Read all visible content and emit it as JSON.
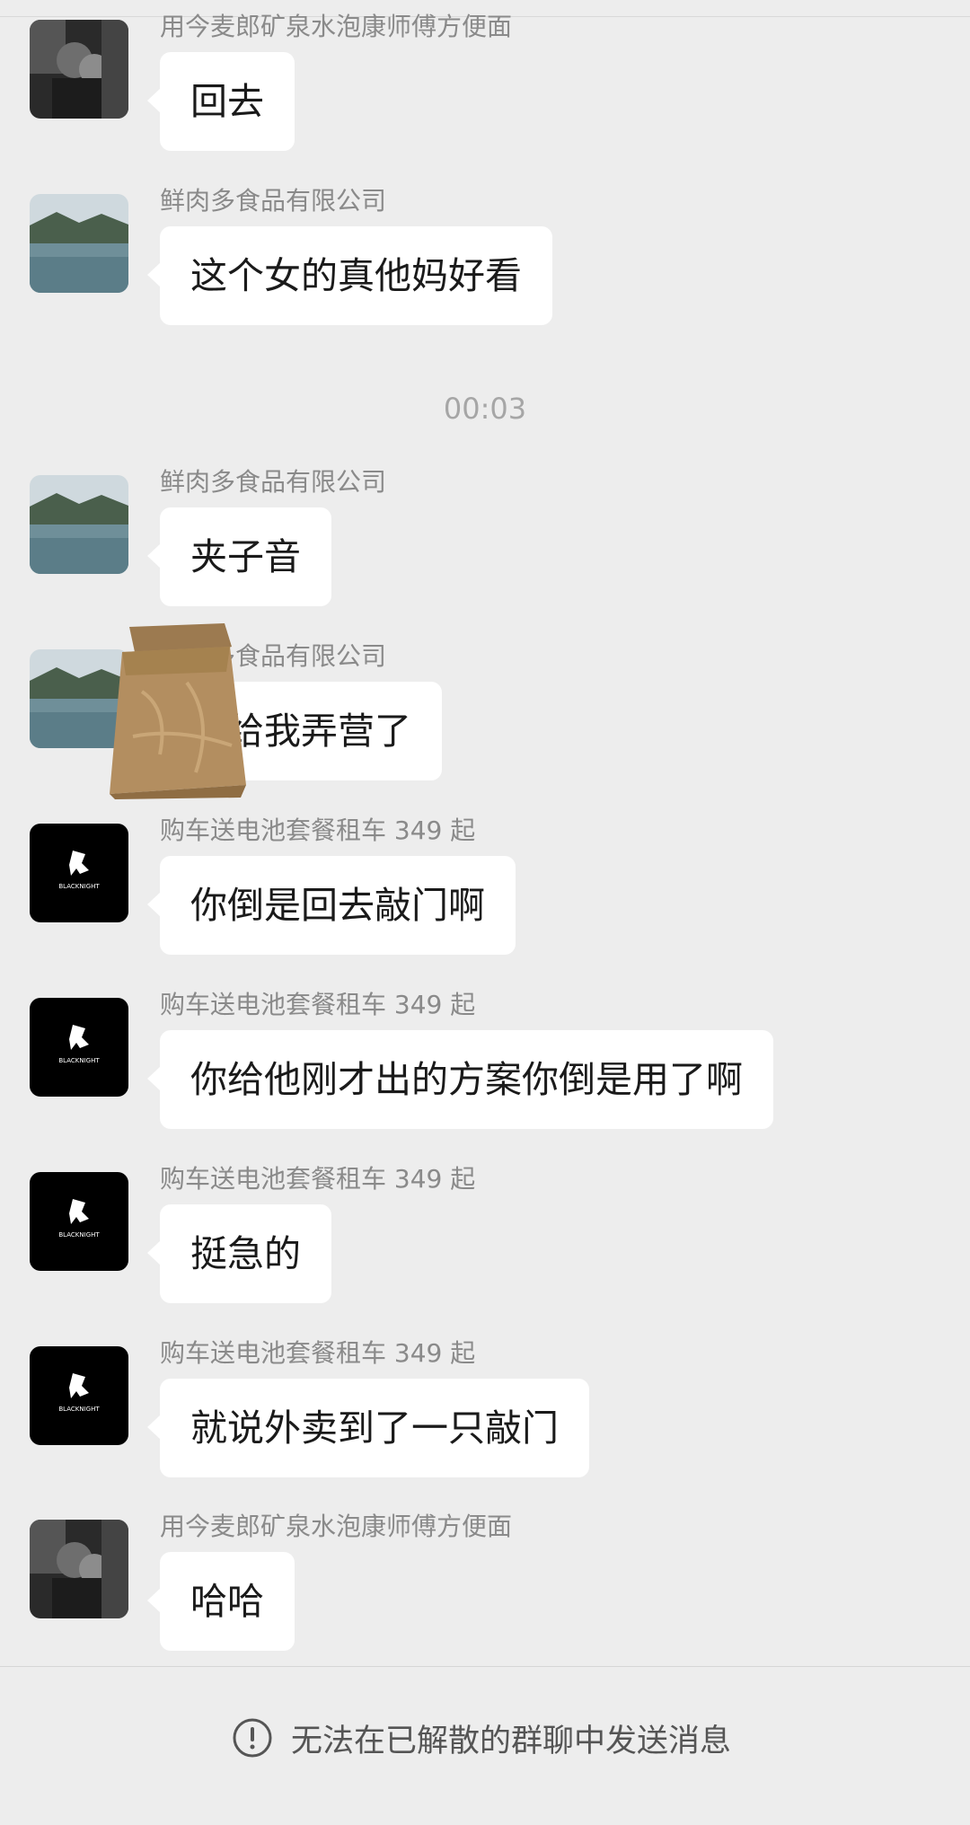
{
  "messages": [
    {
      "sender": "用今麦郎矿泉水泡康师傅方便面",
      "text": "回去",
      "avatar": "couple-photo-avatar"
    },
    {
      "sender": "鲜肉多食品有限公司",
      "text": "这个女的真他妈好看",
      "avatar": "lake-landscape-avatar"
    },
    {
      "sender": "鲜肉多食品有限公司",
      "text": "夹子音",
      "avatar": "lake-landscape-avatar"
    },
    {
      "sender": "鲜肉多食品有限公司",
      "text": "巴给我弄营了",
      "avatar": "lake-landscape-avatar"
    },
    {
      "sender": "购车送电池套餐租车 349 起",
      "text": "你倒是回去敲门啊",
      "avatar": "blackknight-logo-avatar"
    },
    {
      "sender": "购车送电池套餐租车 349 起",
      "text": "你给他刚才出的方案你倒是用了啊",
      "avatar": "blackknight-logo-avatar"
    },
    {
      "sender": "购车送电池套餐租车 349 起",
      "text": "挺急的",
      "avatar": "blackknight-logo-avatar"
    },
    {
      "sender": "购车送电池套餐租车 349 起",
      "text": "就说外卖到了一只敲门",
      "avatar": "blackknight-logo-avatar"
    },
    {
      "sender": "用今麦郎矿泉水泡康师傅方便面",
      "text": "哈哈",
      "avatar": "couple-photo-avatar"
    }
  ],
  "timestamp": "00:03",
  "footer": {
    "notice": "无法在已解散的群聊中发送消息",
    "icon": "exclamation-circle-icon"
  },
  "logo_text": "BLACKNIGHT",
  "sticker": "paper-bag-sticker",
  "colors": {
    "background": "#ededed",
    "bubble": "#ffffff",
    "sender": "#8a8a8a",
    "text": "#1a1a1a"
  }
}
